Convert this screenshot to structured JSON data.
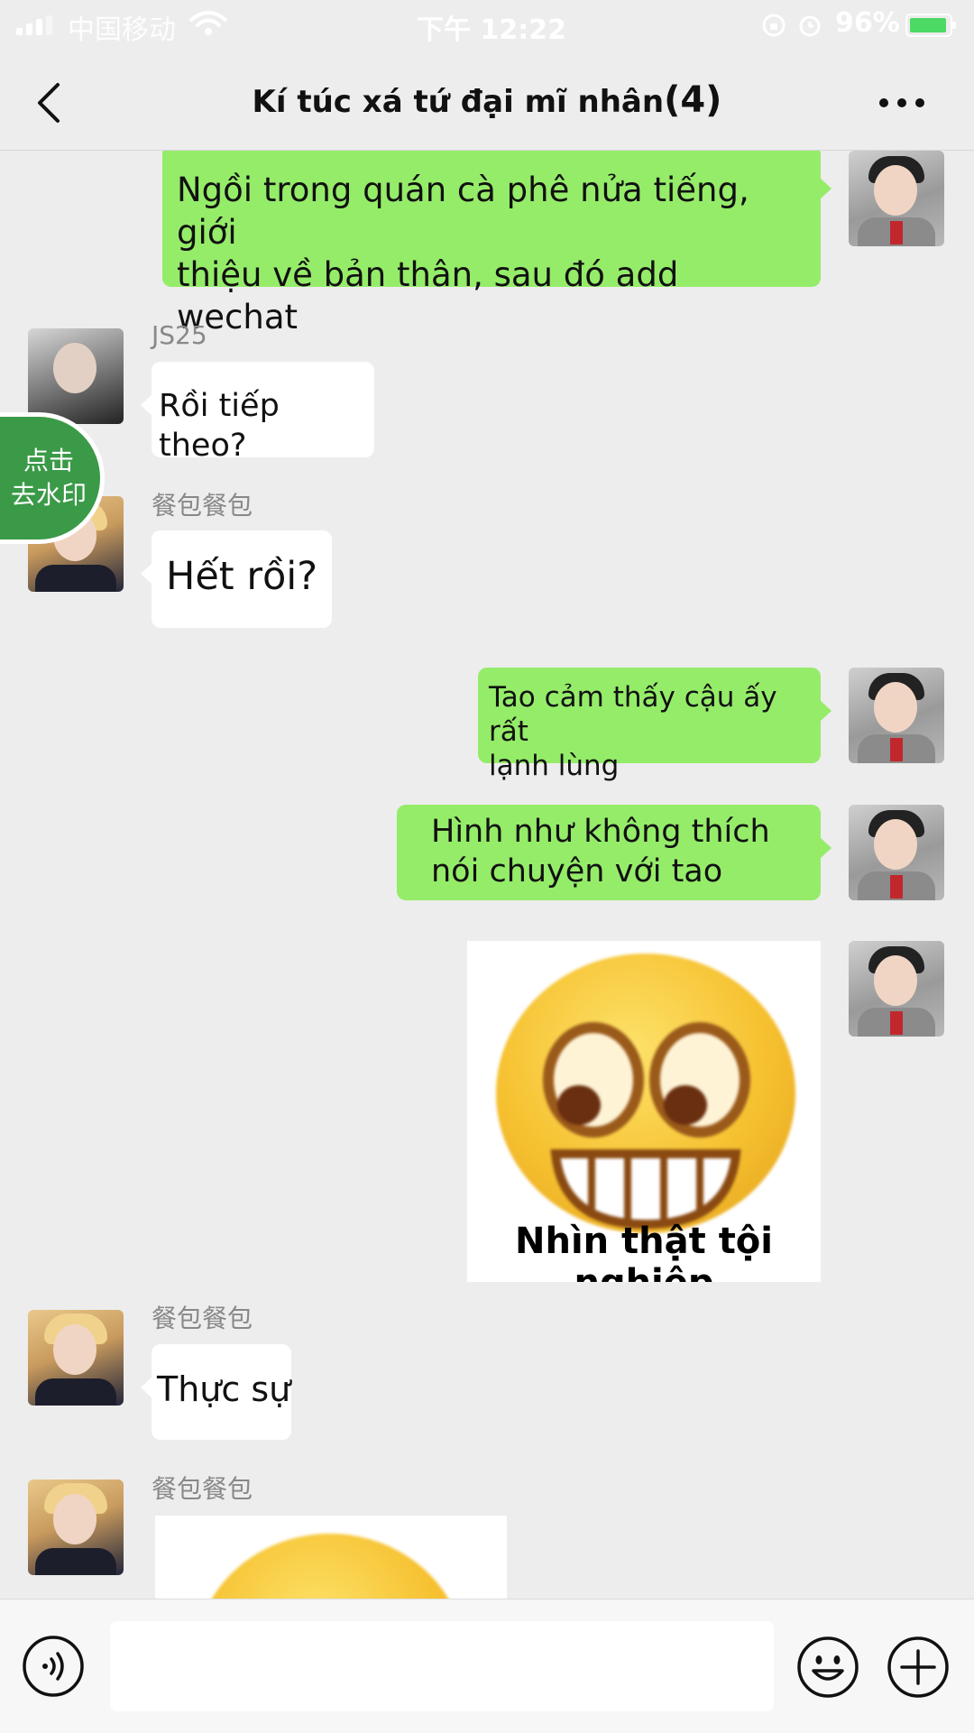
{
  "status_bar": {
    "carrier": "中国移动",
    "time": "下午 12:22",
    "battery": "96%",
    "icons": [
      "signal-icon",
      "wifi-icon",
      "screen-lock-icon",
      "alarm-icon",
      "battery-charging-icon"
    ]
  },
  "header": {
    "title": "Kí túc xá tứ đại mĩ nhân",
    "member_count": "(4)",
    "back_icon": "chevron-left-icon",
    "more_icon": "more-dots-icon"
  },
  "watermark_badge": "点击\n去水印",
  "messages": [
    {
      "side": "right",
      "type": "text",
      "text": "Ngồi trong quán cà phê nửa tiếng, giới\nthiệu về bản thân, sau đó add wechat"
    },
    {
      "side": "left",
      "type": "text",
      "sender": "JS25",
      "text": "Rồi tiếp theo?"
    },
    {
      "side": "left",
      "type": "text",
      "sender": "餐包餐包",
      "text": "Hết rồi?"
    },
    {
      "side": "right",
      "type": "text",
      "text": "Tao cảm thấy cậu ấy rất\n lạnh lùng"
    },
    {
      "side": "right",
      "type": "text",
      "text": "Hình như không thích\nnói chuyện với tao"
    },
    {
      "side": "right",
      "type": "sticker",
      "caption": "Nhìn thật tội nghiệp"
    },
    {
      "side": "left",
      "type": "text",
      "sender": "餐包餐包",
      "text": "Thực sự"
    },
    {
      "side": "left",
      "type": "sticker",
      "sender": "餐包餐包",
      "caption": ""
    }
  ],
  "input_bar": {
    "value": "",
    "icons": [
      "voice-icon",
      "emoji-icon",
      "plus-icon"
    ]
  },
  "colors": {
    "background": "#ededed",
    "bubble_self": "#95ec69",
    "bubble_other": "#ffffff",
    "badge": "#3a9a47"
  }
}
